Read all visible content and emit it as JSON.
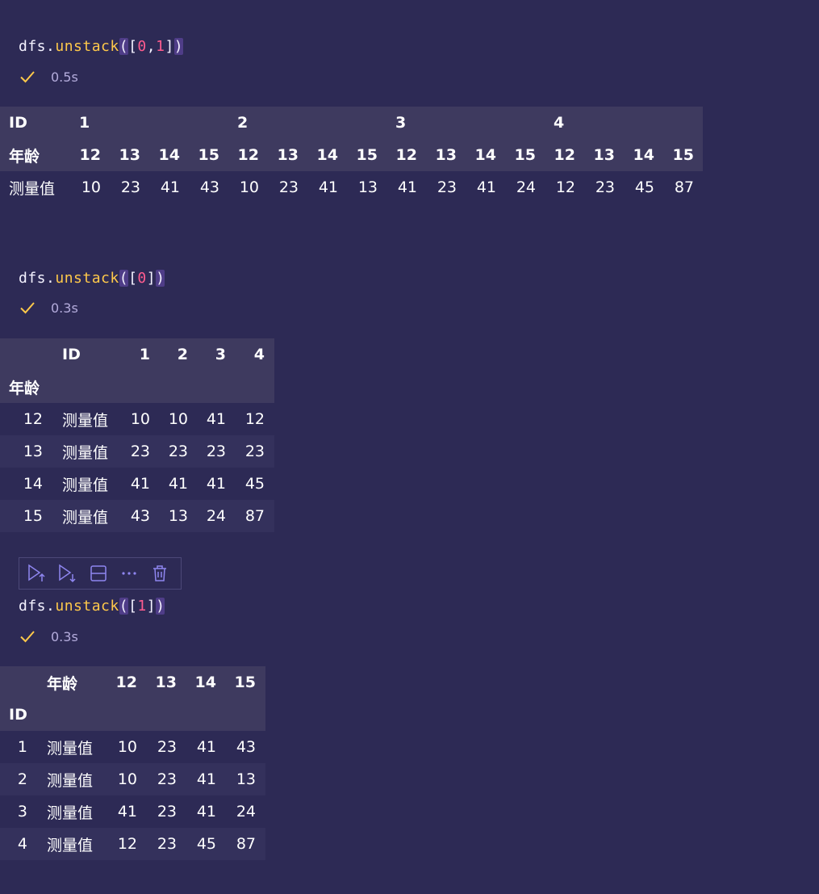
{
  "cell1": {
    "code": {
      "obj": "dfs.",
      "fn": "unstack",
      "open": "(",
      "lb": "[",
      "a": "0",
      "comma": ",",
      "b": "1",
      "rb": "]",
      "close": ")"
    },
    "time": "0.5s",
    "index_name": "ID",
    "level0": [
      "1",
      "2",
      "3",
      "4"
    ],
    "level1_name": "年龄",
    "level1": [
      "12",
      "13",
      "14",
      "15",
      "12",
      "13",
      "14",
      "15",
      "12",
      "13",
      "14",
      "15",
      "12",
      "13",
      "14",
      "15"
    ],
    "row_label": "测量值",
    "values": [
      "10",
      "23",
      "41",
      "43",
      "10",
      "23",
      "41",
      "13",
      "41",
      "23",
      "41",
      "24",
      "12",
      "23",
      "45",
      "87"
    ]
  },
  "cell2": {
    "code": {
      "obj": "dfs.",
      "fn": "unstack",
      "open": "(",
      "lb": "[",
      "a": "0",
      "rb": "]",
      "close": ")"
    },
    "time": "0.3s",
    "columns_name": "ID",
    "columns": [
      "1",
      "2",
      "3",
      "4"
    ],
    "index_name": "年龄",
    "rows": [
      {
        "idx": "12",
        "label": "测量值",
        "vals": [
          "10",
          "10",
          "41",
          "12"
        ]
      },
      {
        "idx": "13",
        "label": "测量值",
        "vals": [
          "23",
          "23",
          "23",
          "23"
        ]
      },
      {
        "idx": "14",
        "label": "测量值",
        "vals": [
          "41",
          "41",
          "41",
          "45"
        ]
      },
      {
        "idx": "15",
        "label": "测量值",
        "vals": [
          "43",
          "13",
          "24",
          "87"
        ]
      }
    ]
  },
  "toolbar": {
    "icons": [
      "run-above-icon",
      "run-below-icon",
      "split-cell-icon",
      "more-icon",
      "delete-icon"
    ],
    "accent": "#8f86f0"
  },
  "cell3": {
    "code": {
      "obj": "dfs.",
      "fn": "unstack",
      "open": "(",
      "lb": "[",
      "a": "1",
      "rb": "]",
      "close": ")"
    },
    "time": "0.3s",
    "columns_name": "年龄",
    "columns": [
      "12",
      "13",
      "14",
      "15"
    ],
    "index_name": "ID",
    "rows": [
      {
        "idx": "1",
        "label": "测量值",
        "vals": [
          "10",
          "23",
          "41",
          "43"
        ]
      },
      {
        "idx": "2",
        "label": "测量值",
        "vals": [
          "10",
          "23",
          "41",
          "13"
        ]
      },
      {
        "idx": "3",
        "label": "测量值",
        "vals": [
          "41",
          "23",
          "41",
          "24"
        ]
      },
      {
        "idx": "4",
        "label": "测量值",
        "vals": [
          "12",
          "23",
          "45",
          "87"
        ]
      }
    ]
  },
  "colors": {
    "background": "#2d2a55",
    "header": "#3e3a5f",
    "stripe": "#34315c",
    "check": "#ffc94a",
    "function": "#ffc94a",
    "number": "#ff5c8f"
  }
}
